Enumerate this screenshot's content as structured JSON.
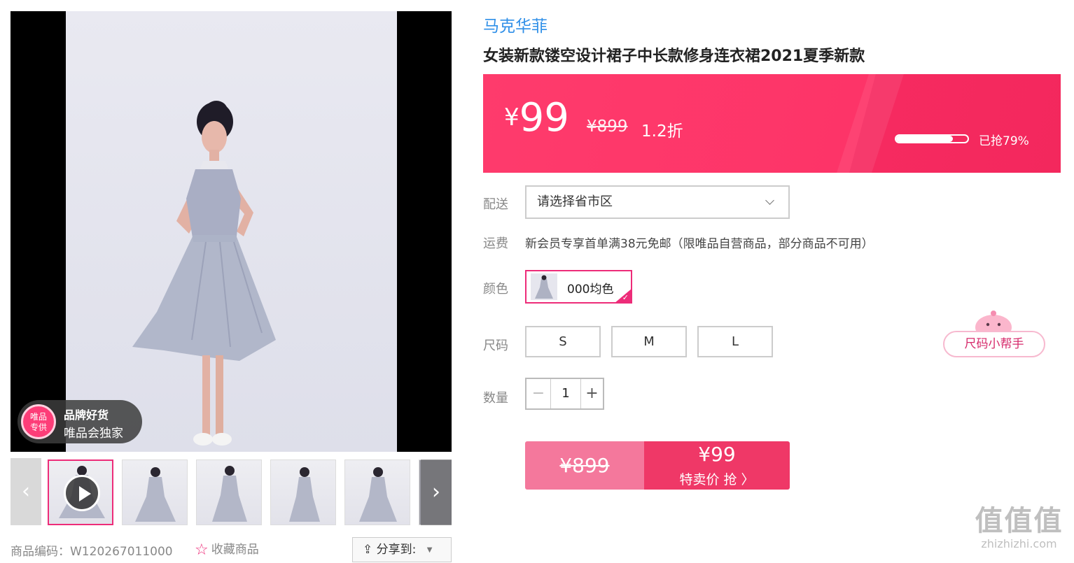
{
  "gallery": {
    "badge": {
      "circle_line1": "唯品",
      "circle_line2": "专供",
      "title": "品牌好货",
      "subtitle": "唯品会独家"
    },
    "thumb_prev_icon": "chevron-left-icon",
    "thumb_next_icon": "chevron-right-icon",
    "play_icon": "play-icon"
  },
  "meta": {
    "sku_label": "商品编码：",
    "sku_value": "W120267011000",
    "favorite_label": "收藏商品",
    "favorite_icon": "star-icon",
    "share_label": "分享到:",
    "share_icon": "share-icon"
  },
  "product": {
    "brand": "马克华菲",
    "title": "女装新款镂空设计裙子中长款修身连衣裙2021夏季新款"
  },
  "price": {
    "currency": "¥",
    "current": "99",
    "original": "¥899",
    "discount": "1.2折",
    "sold_text": "已抢79%",
    "sold_fraction": 0.79
  },
  "delivery": {
    "label": "配送",
    "placeholder": "请选择省市区"
  },
  "shipping": {
    "label": "运费",
    "text": "新会员专享首单满38元免邮（限唯品自营商品，部分商品不可用）"
  },
  "color": {
    "label": "颜色",
    "option": "000均色"
  },
  "size": {
    "label": "尺码",
    "options": [
      "S",
      "M",
      "L"
    ],
    "helper": "尺码小帮手"
  },
  "quantity": {
    "label": "数量",
    "minus": "−",
    "value": "1",
    "plus": "+"
  },
  "buy": {
    "original": "¥899",
    "price": "¥99",
    "cta": "特卖价 抢 〉"
  },
  "watermark": {
    "chars": "值值值",
    "domain": "zhizhizhi.com"
  },
  "colors": {
    "accent": "#ed2c79",
    "banner": "#fd3468",
    "brand_link": "#2f8fe8"
  }
}
